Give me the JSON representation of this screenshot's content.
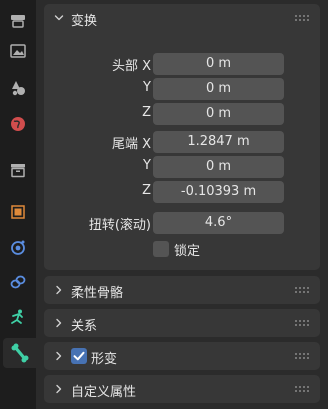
{
  "colors": {
    "background": "#2b2b2b",
    "tabstrip": "#1d1d1d",
    "panel": "#373737",
    "field": "#545454",
    "accent_blue": "#4772b3",
    "bone_green": "#3fd0a6"
  },
  "tabs": [
    {
      "icon": "tool-icon"
    },
    {
      "icon": "render-icon"
    },
    {
      "icon": "output-icon"
    },
    {
      "icon": "world-icon"
    },
    {
      "icon": "collection-icon"
    },
    {
      "icon": "object-icon"
    },
    {
      "icon": "physics-icon"
    },
    {
      "icon": "constraint-icon"
    },
    {
      "icon": "armature-data-icon"
    },
    {
      "icon": "bone-icon",
      "active": true
    }
  ],
  "transform_panel": {
    "title": "变换",
    "head_label": "头部 X",
    "y_label": "Y",
    "z_label": "Z",
    "head": {
      "x": "0 m",
      "y": "0 m",
      "z": "0 m"
    },
    "tail_label": "尾端 X",
    "tail": {
      "x": "1.2847 m",
      "y": "0 m",
      "z": "-0.10393 m"
    },
    "roll_label": "扭转(滚动)",
    "roll": "4.6°",
    "lock_label": "锁定",
    "lock_checked": false
  },
  "panels": {
    "bendy_bones": "柔性骨骼",
    "relations": "关系",
    "deform": "形变",
    "deform_checked": true,
    "custom_props": "自定义属性"
  }
}
